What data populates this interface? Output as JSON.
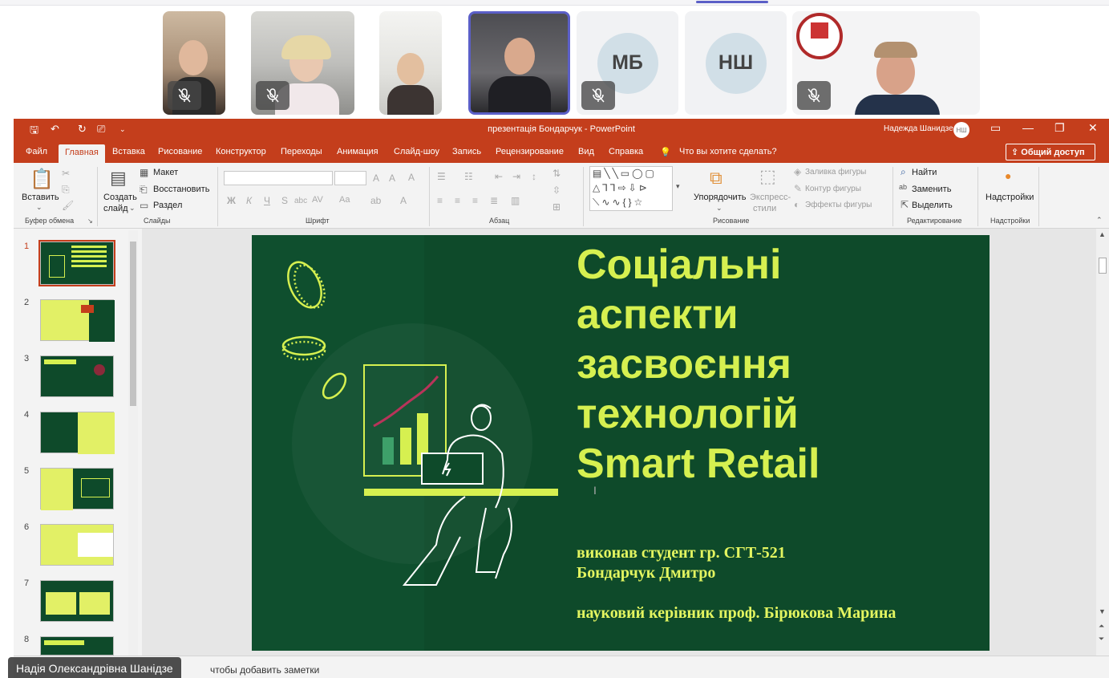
{
  "meeting": {
    "participants": [
      {
        "type": "video",
        "muted": true
      },
      {
        "type": "video",
        "muted": true
      },
      {
        "type": "video",
        "muted": false
      },
      {
        "type": "video",
        "muted": false,
        "active_speaker": true
      },
      {
        "type": "avatar",
        "initials": "МБ",
        "muted": true
      },
      {
        "type": "avatar",
        "initials": "НШ",
        "muted": false
      },
      {
        "type": "video",
        "muted": true
      }
    ],
    "presenter_label": "Надія Олександрівна Шанідзе"
  },
  "window": {
    "title": "презентація Бондарчук  -  PowerPoint",
    "user_name": "Надежда Шанидзе",
    "user_initials": "НШ"
  },
  "tabs": [
    "Файл",
    "Главная",
    "Вставка",
    "Рисование",
    "Конструктор",
    "Переходы",
    "Анимация",
    "Слайд-шоу",
    "Запись",
    "Рецензирование",
    "Вид",
    "Справка"
  ],
  "active_tab": "Главная",
  "tell_me": "Что вы хотите сделать?",
  "share_label": "Общий доступ",
  "ribbon": {
    "paste": "Вставить",
    "new_slide_1": "Создать",
    "new_slide_2": "слайд",
    "layout": "Макет",
    "reset": "Восстановить",
    "section": "Раздел",
    "arrange": "Упорядочить",
    "quick_styles_1": "Экспресс-",
    "quick_styles_2": "стили",
    "shape_fill": "Заливка фигуры",
    "shape_outline": "Контур фигуры",
    "shape_effects": "Эффекты фигуры",
    "find": "Найти",
    "replace": "Заменить",
    "select": "Выделить",
    "addins": "Надстройки",
    "groups": {
      "clipboard": "Буфер обмена",
      "slides": "Слайды",
      "font": "Шрифт",
      "paragraph": "Абзац",
      "drawing": "Рисование",
      "editing": "Редактирование",
      "addins": "Надстройки"
    }
  },
  "thumbnails": [
    "1",
    "2",
    "3",
    "4",
    "5",
    "6",
    "7",
    "8"
  ],
  "selected_slide": "1",
  "slide": {
    "title_lines": [
      "Соціальні",
      "аспекти",
      "засвоєння",
      "технологій",
      "Smart Retail"
    ],
    "author_line1": "виконав студент гр. СГТ-521",
    "author_line2": "Бондарчук Дмитро",
    "supervisor": "науковий керівник проф. Бірюкова Марина"
  },
  "notes_placeholder": "чтобы добавить заметки",
  "colors": {
    "ppt_accent": "#c43e1c",
    "slide_bg": "#0e4a2a",
    "slide_text": "#d6f050",
    "teams_accent": "#5b5fc7"
  }
}
